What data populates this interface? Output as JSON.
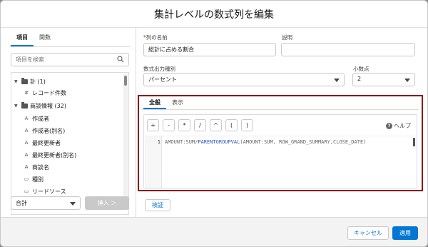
{
  "dialog": {
    "title": "集計レベルの数式列を編集"
  },
  "left_panel": {
    "tabs": [
      {
        "label": "項目",
        "active": true
      },
      {
        "label": "関数",
        "active": false
      }
    ],
    "search_placeholder": "項目を検索",
    "tree": [
      {
        "type": "folder",
        "label": "計 (1)"
      },
      {
        "type": "field",
        "icon": "#",
        "label": "レコード件数"
      },
      {
        "type": "folder",
        "label": "商談情報 (32)"
      },
      {
        "type": "field",
        "icon": "A",
        "label": "作成者"
      },
      {
        "type": "field",
        "icon": "A",
        "label": "作成者(別名)"
      },
      {
        "type": "field",
        "icon": "A",
        "label": "最終更新者"
      },
      {
        "type": "field",
        "icon": "A",
        "label": "最終更新者(別名)"
      },
      {
        "type": "field",
        "icon": "A",
        "label": "商談名"
      },
      {
        "type": "field",
        "icon": "▭",
        "label": "種別"
      },
      {
        "type": "field",
        "icon": "▭",
        "label": "リードソース"
      }
    ],
    "aggregate_select": "合計",
    "insert_button": "挿入 ＞"
  },
  "form": {
    "column_name_label": "列の名前",
    "column_name_value": "総計に占める割合",
    "description_label": "説明",
    "description_value": "",
    "format_label": "数式出力種別",
    "format_value": "パーセント",
    "decimal_label": "小数点",
    "decimal_value": "2"
  },
  "editor": {
    "tabs": [
      {
        "label": "全般",
        "active": true
      },
      {
        "label": "表示",
        "active": false
      }
    ],
    "operators": [
      "+",
      "-",
      "*",
      "/",
      "^",
      "(",
      ")"
    ],
    "help_label": "ヘルプ",
    "line_number": "1",
    "code_part1": "AMOUNT:SUM/",
    "code_fn": "PARENTGROUPVAL",
    "code_part2": "(AMOUNT:SUM, ROW_GRAND_SUMMARY,CLOSE_DATE)",
    "verify_button": "検証"
  },
  "footer": {
    "cancel": "キャンセル",
    "apply": "適用"
  },
  "colors": {
    "brand": "#0176d3",
    "highlight_border": "#8b1a1a"
  }
}
